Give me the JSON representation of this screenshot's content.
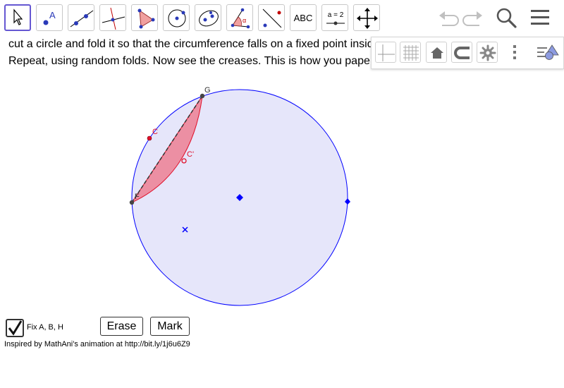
{
  "toolbar": {
    "tools": [
      {
        "name": "move-tool"
      },
      {
        "name": "point-tool",
        "icon_text": "A"
      },
      {
        "name": "line-tool"
      },
      {
        "name": "perpendicular-line-tool"
      },
      {
        "name": "polygon-tool"
      },
      {
        "name": "circle-tool"
      },
      {
        "name": "conic-tool"
      },
      {
        "name": "angle-tool",
        "icon_text": "α"
      },
      {
        "name": "reflect-tool"
      },
      {
        "name": "text-tool",
        "icon_text": "ABC"
      },
      {
        "name": "slider-tool",
        "icon_text": "a = 2"
      },
      {
        "name": "move-graphics-view-tool"
      }
    ],
    "right_icons": [
      "undo-icon",
      "redo-icon",
      "search-icon",
      "menu-icon"
    ]
  },
  "description": {
    "line1": "cut a circle and fold it so that the circumference falls on a fixed point insid",
    "line2": "Repeat, using random folds. Now see the creases. This is how you pape"
  },
  "style_bar": {
    "icons": [
      "axes-icon",
      "grid-icon",
      "home-icon",
      "point-capturing-icon",
      "settings-icon",
      "more-vertical-icon",
      "toggle-style-bar-icon"
    ]
  },
  "graphics": {
    "labels": {
      "G": "G",
      "C": "C",
      "C_prime": "C'",
      "F": "F"
    },
    "colors": {
      "circle_stroke": "#0000ff",
      "circle_fill": "#e6e6fa",
      "fold_fill": "#ec8fa3",
      "fold_stroke": "#e0102a",
      "point_red": "#e0102a",
      "point_dark": "#444444"
    }
  },
  "controls": {
    "fix_checkbox": {
      "label": "Fix A, B, H",
      "checked": true
    },
    "erase_button": "Erase",
    "mark_button": "Mark"
  },
  "footer": {
    "credit": "Inspired by MathAni's animation at http://bit.ly/1j6u6Z9"
  }
}
